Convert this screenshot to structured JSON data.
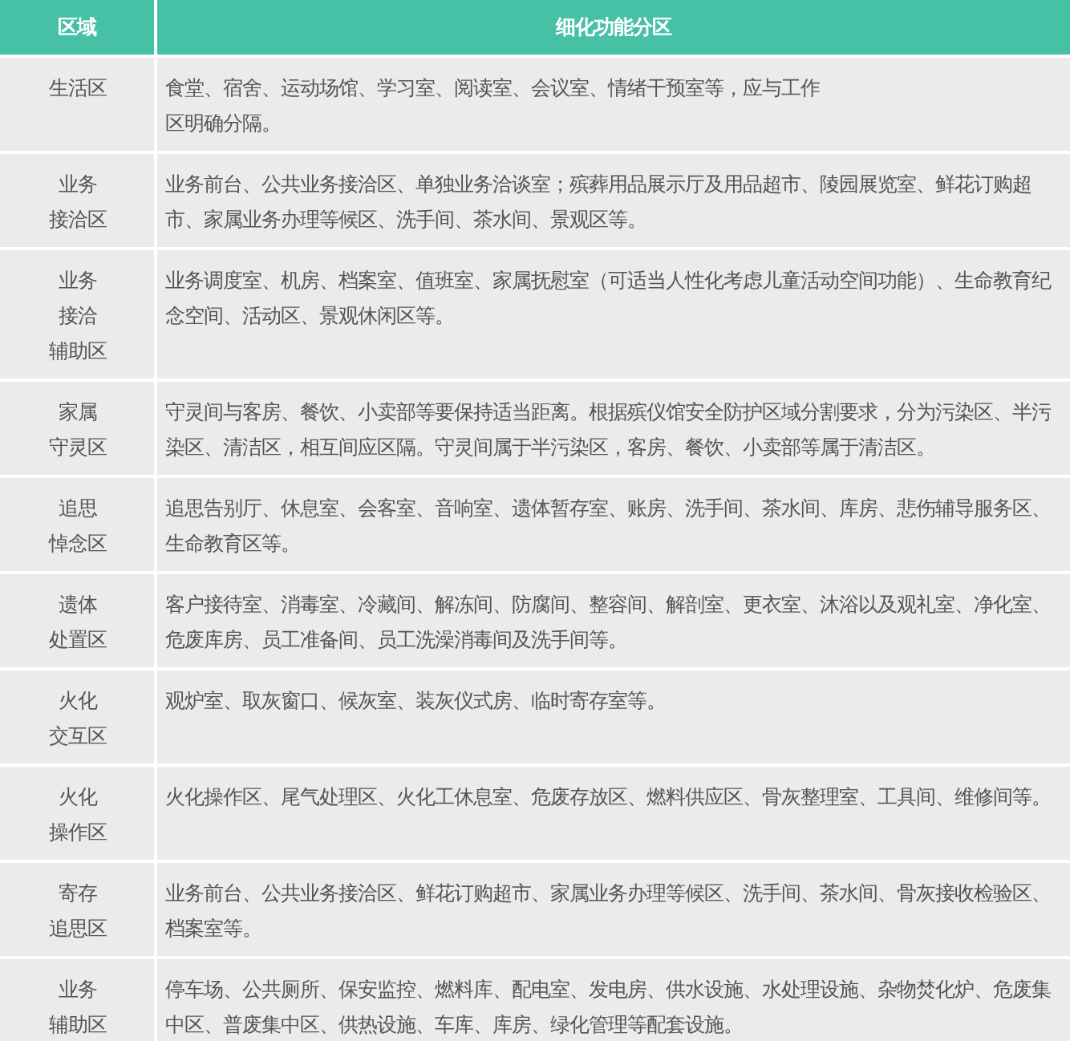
{
  "table": {
    "columns": [
      "区域",
      "细化功能分区"
    ],
    "rows": [
      {
        "zone": [
          "生活区"
        ],
        "detail": [
          "食堂、宿舍、运动场馆、学习室、阅读室、会议室、情绪干预室等，应与工作",
          "区明确分隔。"
        ]
      },
      {
        "zone": [
          "业务",
          "接洽区"
        ],
        "detail": [
          "业务前台、公共业务接洽区、单独业务洽谈室；殡葬用品展示厅及用品超市、陵园展览室、鲜花订购超",
          "市、家属业务办理等候区、洗手间、茶水间、景观区等。"
        ]
      },
      {
        "zone": [
          "业务",
          "接洽",
          "辅助区"
        ],
        "detail": [
          "业务调度室、机房、档案室、值班室、家属抚慰室（可适当人性化考虑儿童活动空间功能）、生命教育纪",
          "念空间、活动区、景观休闲区等。"
        ]
      },
      {
        "zone": [
          "家属",
          "守灵区"
        ],
        "detail": [
          "守灵间与客房、餐饮、小卖部等要保持适当距离。根据殡仪馆安全防护区域分割要求，分为污染区、半污",
          "染区、清洁区，相互间应区隔。守灵间属于半污染区，客房、餐饮、小卖部等属于清洁区。"
        ]
      },
      {
        "zone": [
          "追思",
          "悼念区"
        ],
        "detail": [
          "追思告别厅、休息室、会客室、音响室、遗体暂存室、账房、洗手间、茶水间、库房、悲伤辅导服务区、",
          "生命教育区等。"
        ]
      },
      {
        "zone": [
          "遗体",
          "处置区"
        ],
        "detail": [
          "客户接待室、消毒室、冷藏间、解冻间、防腐间、整容间、解剖室、更衣室、沐浴以及观礼室、净化室、",
          "危废库房、员工准备间、员工洗澡消毒间及洗手间等。"
        ]
      },
      {
        "zone": [
          "火化",
          "交互区"
        ],
        "detail": [
          "观炉室、取灰窗口、候灰室、装灰仪式房、临时寄存室等。"
        ]
      },
      {
        "zone": [
          "火化",
          "操作区"
        ],
        "detail": [
          "火化操作区、尾气处理区、火化工休息室、危废存放区、燃料供应区、骨灰整理室、工具间、维修间等。"
        ]
      },
      {
        "zone": [
          "寄存",
          "追思区"
        ],
        "detail": [
          "业务前台、公共业务接洽区、鲜花订购超市、家属业务办理等候区、洗手间、茶水间、骨灰接收检验区、",
          "档案室等。"
        ]
      },
      {
        "zone": [
          "业务",
          "辅助区"
        ],
        "detail": [
          "停车场、公共厕所、保安监控、燃料库、配电室、发电房、供水设施、水处理设施、杂物焚化炉、危废集",
          "中区、普废集中区、供热设施、车库、库房、绿化管理等配套设施。"
        ]
      }
    ]
  }
}
